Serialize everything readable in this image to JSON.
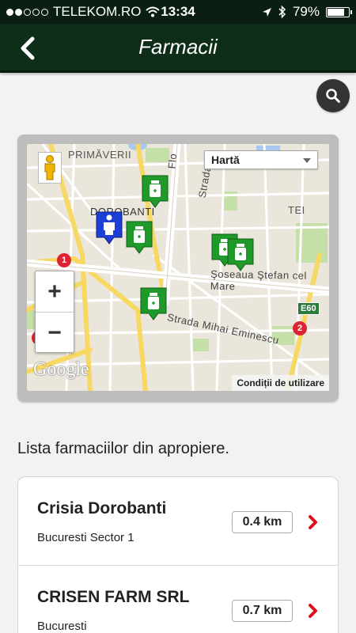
{
  "status_bar": {
    "carrier": "TELEKOM.RO",
    "time": "13:34",
    "battery": "79%",
    "battery_level": 0.79,
    "signal_bars": 2,
    "signal_total": 5
  },
  "nav": {
    "title": "Farmacii",
    "back_icon": "chevron-left-icon",
    "bar_color": "#0e2e1a"
  },
  "search": {
    "icon": "search-icon"
  },
  "map": {
    "map_type": "Hartă",
    "terms": "Condiții de utilizare",
    "logo": "Google",
    "zoom_in": "+",
    "zoom_out": "−",
    "labels": {
      "primaverii": "PRIMĂVERII",
      "dorobanti": "DOROBANTI",
      "tei": "TEI",
      "stefan": "Şoseaua Ştefan cel Mare",
      "eminescu": "Strada Mihai Eminescu",
      "strada_v": "Strada",
      "flo": "Flo",
      "e60": "E60",
      "r1": "1",
      "r2": "2"
    },
    "marker_color": "#1f9a2a",
    "user_marker_color": "#1e3fd6"
  },
  "list": {
    "heading": "Lista farmaciilor din apropiere.",
    "items": [
      {
        "name": "Crisia Dorobanti",
        "address": "Bucuresti Sector 1",
        "distance": "0.4 km"
      },
      {
        "name": "CRISEN FARM SRL",
        "address": "Bucuresti",
        "distance": "0.7 km"
      }
    ],
    "chevron_color": "#e0101a"
  }
}
